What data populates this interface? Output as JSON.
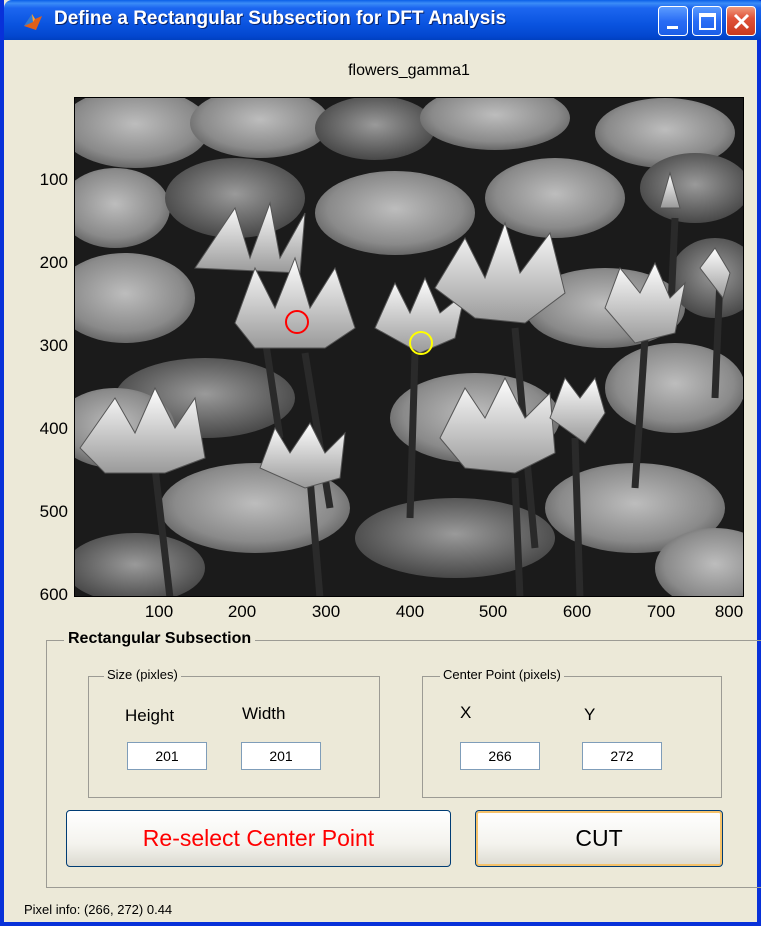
{
  "window": {
    "title": "Define a Rectangular Subsection for DFT Analysis",
    "colors": {
      "titlebar": "#0a54e0",
      "face": "#ece9d8",
      "close": "#e0533a"
    }
  },
  "axes": {
    "title": "flowers_gamma1",
    "y_ticks": [
      "100",
      "200",
      "300",
      "400",
      "500",
      "600"
    ],
    "x_ticks": [
      "100",
      "200",
      "300",
      "400",
      "500",
      "600",
      "700",
      "800"
    ],
    "image_description_icon": "grayscale-water-lily-photo",
    "markers": [
      {
        "name": "selected-center",
        "color": "#ff0000",
        "x": 266,
        "y": 272
      },
      {
        "name": "other-point",
        "color": "#ffff00",
        "x": 415,
        "y": 295
      }
    ]
  },
  "panel": {
    "title": "Rectangular Subsection",
    "size_group": {
      "title": "Size  (pixles)",
      "height_label": "Height",
      "width_label": "Width",
      "height_value": "201",
      "width_value": "201"
    },
    "center_group": {
      "title": "Center Point (pixels)",
      "x_label": "X",
      "y_label": "Y",
      "x_value": "266",
      "y_value": "272"
    },
    "reselect_label": "Re-select Center Point",
    "cut_label": "CUT",
    "reselect_color": "#ff0000"
  },
  "status": {
    "pixel_info": "Pixel info: (266, 272)  0.44"
  }
}
